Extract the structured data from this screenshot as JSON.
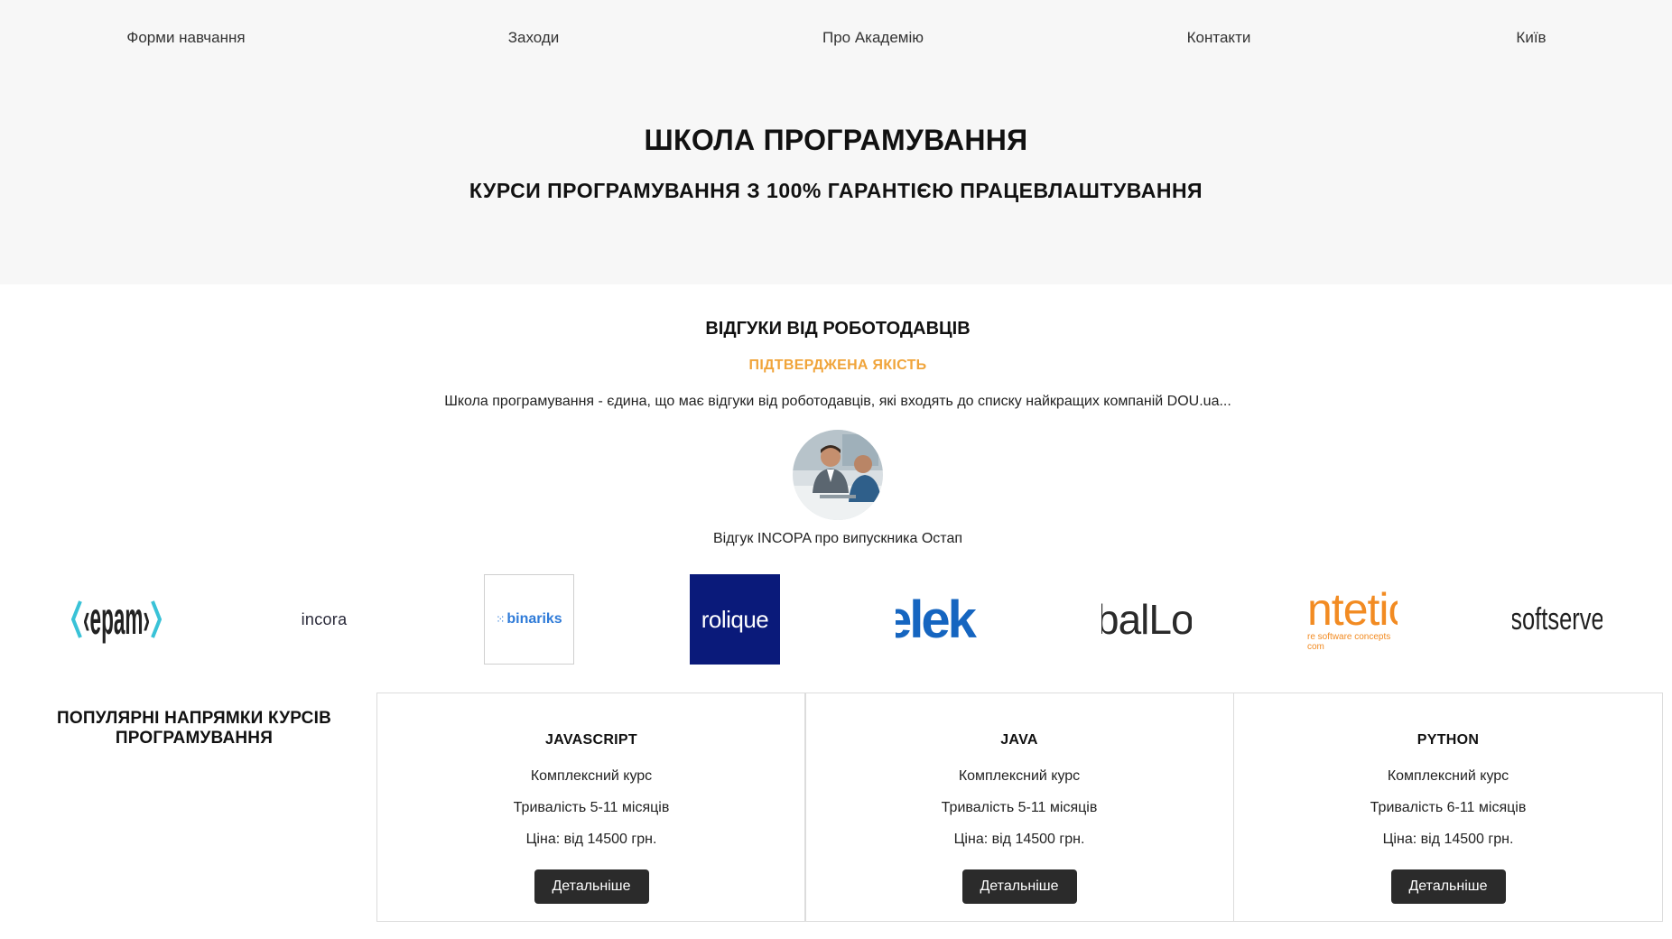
{
  "nav": {
    "items": [
      "Форми навчання",
      "Заходи",
      "Про Академію",
      "Контакти",
      "Київ"
    ]
  },
  "hero": {
    "title": "ШКОЛА ПРОГРАМУВАННЯ",
    "subtitle": "КУРСИ ПРОГРАМУВАННЯ З 100% ГАРАНТІЄЮ ПРАЦЕВЛАШТУВАННЯ"
  },
  "reviews": {
    "title": "ВІДГУКИ ВІД РОБОТОДАВЦІВ",
    "quality": "ПІДТВЕРДЖЕНА ЯКІСТЬ",
    "text": "Школа програмування - єдина, що має відгуки від роботодавців, які входять до списку найкращих компаній DOU.ua...",
    "caption": "Відгук INCOPA про випускника Остап"
  },
  "logos": [
    {
      "name": "epam",
      "text": "‹epam›"
    },
    {
      "name": "incora",
      "text": "incora"
    },
    {
      "name": "binariks",
      "text": "binariks"
    },
    {
      "name": "rolique",
      "text": "rolique"
    },
    {
      "name": "elek",
      "text": "elek"
    },
    {
      "name": "ballo",
      "text": "balLo"
    },
    {
      "name": "intetics",
      "text": "ntetic",
      "sub": "re software concepts com"
    },
    {
      "name": "softserve",
      "text": "softserve"
    }
  ],
  "colors": {
    "accent": "#f0a43a",
    "button": "#2b2b2b",
    "rolique_bg": "#0a1a7a",
    "elek": "#1565c0",
    "intetics": "#f28b22"
  },
  "courses": {
    "section_title": "ПОПУЛЯРНІ НАПРЯМКИ КУРСІВ ПРОГРАМУВАННЯ",
    "cards": [
      {
        "title": "JAVASCRIPT",
        "type": "Комплексний курс",
        "duration": "Тривалість 5-11 місяців",
        "price": "Ціна: від 14500 грн.",
        "button": "Детальніше"
      },
      {
        "title": "JAVA",
        "type": "Комплексний курс",
        "duration": "Тривалість 5-11 місяців",
        "price": "Ціна: від 14500 грн.",
        "button": "Детальніше"
      },
      {
        "title": "PYTHON",
        "type": "Комплексний курс",
        "duration": "Тривалість 6-11 місяців",
        "price": "Ціна: від 14500 грн.",
        "button": "Детальніше"
      }
    ]
  }
}
